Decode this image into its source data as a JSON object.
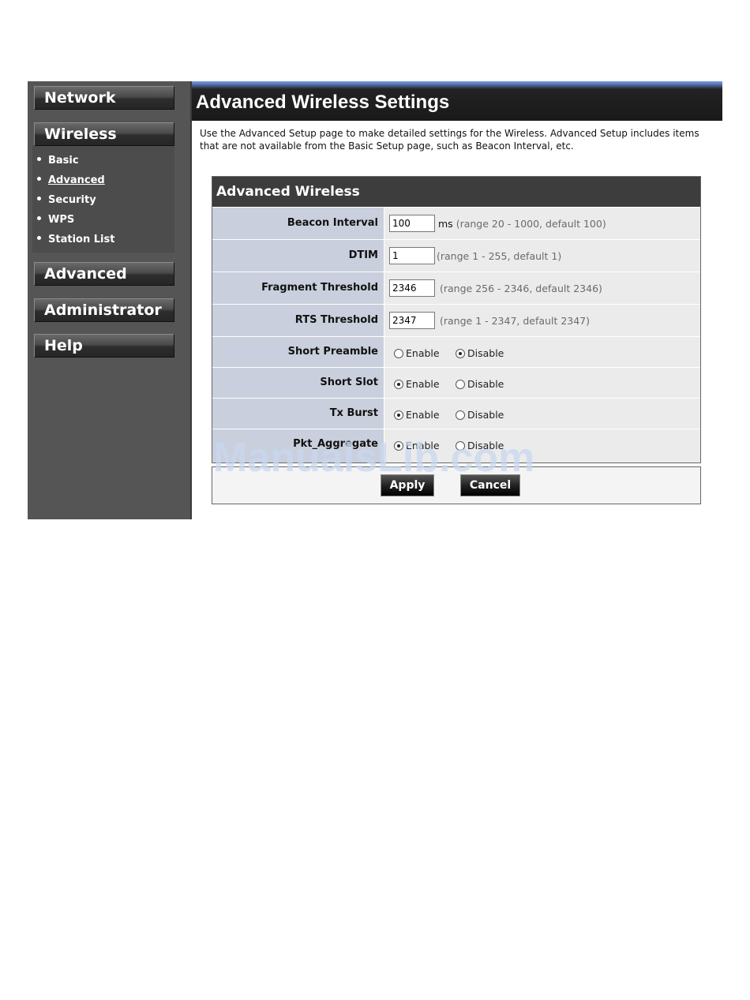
{
  "sidebar": {
    "nav": [
      {
        "label": "Network"
      },
      {
        "label": "Wireless"
      },
      {
        "label": "Advanced"
      },
      {
        "label": "Administrator"
      },
      {
        "label": "Help"
      }
    ],
    "submenu": [
      {
        "label": "Basic"
      },
      {
        "label": "Advanced",
        "active": true
      },
      {
        "label": "Security"
      },
      {
        "label": "WPS"
      },
      {
        "label": "Station List"
      }
    ]
  },
  "main": {
    "title": "Advanced Wireless Settings",
    "intro": "Use the Advanced Setup page to make detailed settings for the Wireless. Advanced Setup includes items that are not available from the Basic Setup page, such as Beacon Interval, etc.",
    "panel_title": "Advanced Wireless",
    "fields": {
      "beacon": {
        "label": "Beacon Interval",
        "value": "100",
        "unit": "ms",
        "hint": "(range 20 - 1000, default 100)"
      },
      "dtim": {
        "label": "DTIM",
        "value": "1",
        "hint": "(range 1 - 255, default 1)"
      },
      "frag": {
        "label": "Fragment Threshold",
        "value": "2346",
        "hint": "(range 256 - 2346, default 2346)"
      },
      "rts": {
        "label": "RTS Threshold",
        "value": "2347",
        "hint": "(range 1 - 2347, default 2347)"
      },
      "preamble": {
        "label": "Short Preamble",
        "selected": "Disable"
      },
      "slot": {
        "label": "Short Slot",
        "selected": "Enable"
      },
      "burst": {
        "label": "Tx Burst",
        "selected": "Enable"
      },
      "aggregate": {
        "label": "Pkt_Aggregate",
        "selected": "Enable"
      }
    },
    "radio_enable": "Enable",
    "radio_disable": "Disable",
    "apply_label": "Apply",
    "cancel_label": "Cancel"
  },
  "watermark": "ManualsLib.com",
  "colors": {
    "sidebar_bg": "#555555",
    "label_bg": "#c9cfdc",
    "value_bg": "#ebebeb",
    "header_bg": "#1a1a1a",
    "accent_blue": "#5d7fc4"
  }
}
